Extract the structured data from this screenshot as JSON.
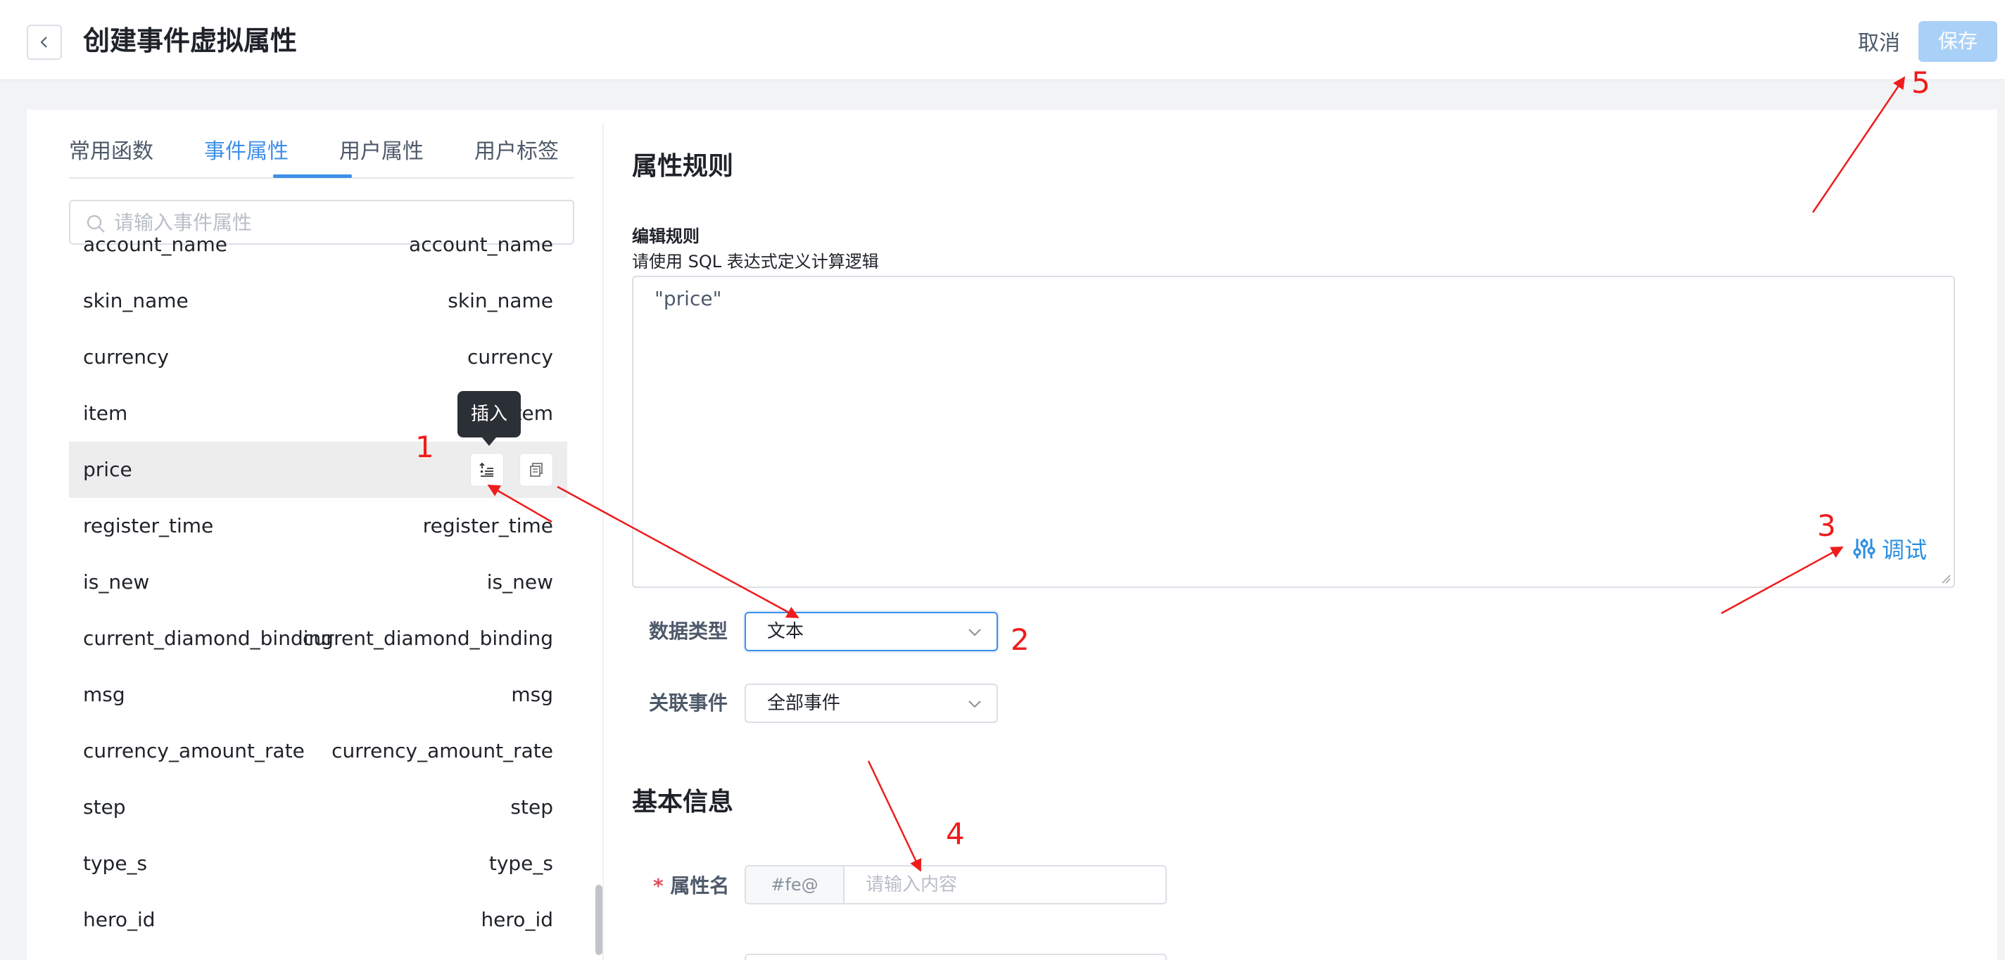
{
  "header": {
    "title": "创建事件虚拟属性",
    "cancel_label": "取消",
    "save_label": "保存"
  },
  "tabs": [
    {
      "label": "常用函数",
      "active": false
    },
    {
      "label": "事件属性",
      "active": true
    },
    {
      "label": "用户属性",
      "active": false
    },
    {
      "label": "用户标签",
      "active": false
    }
  ],
  "search": {
    "placeholder": "请输入事件属性"
  },
  "properties": [
    {
      "name": "account_name",
      "display": "account_name"
    },
    {
      "name": "skin_name",
      "display": "skin_name"
    },
    {
      "name": "currency",
      "display": "currency"
    },
    {
      "name": "item",
      "display": "item"
    },
    {
      "name": "price",
      "display": ""
    },
    {
      "name": "register_time",
      "display": "register_time"
    },
    {
      "name": "is_new",
      "display": "is_new"
    },
    {
      "name": "current_diamond_binding",
      "display": "current_diamond_binding"
    },
    {
      "name": "msg",
      "display": "msg"
    },
    {
      "name": "currency_amount_rate",
      "display": "currency_amount_rate"
    },
    {
      "name": "step",
      "display": "step"
    },
    {
      "name": "type_s",
      "display": "type_s"
    },
    {
      "name": "hero_id",
      "display": "hero_id"
    }
  ],
  "tooltip": {
    "text": "插入"
  },
  "rules": {
    "section_title": "属性规则",
    "edit_label": "编辑规则",
    "edit_desc": "请使用 SQL 表达式定义计算逻辑",
    "expression": "\"price\"",
    "debug_label": "调试"
  },
  "data_type": {
    "label": "数据类型",
    "value": "文本"
  },
  "related_event": {
    "label": "关联事件",
    "value": "全部事件"
  },
  "basic_info": {
    "section_title": "基本信息",
    "name_label": "属性名",
    "required_mark": "*",
    "name_prefix": "#fe@",
    "name_placeholder": "请输入内容"
  },
  "annotations": [
    "1",
    "2",
    "3",
    "4",
    "5"
  ],
  "colors": {
    "accent": "#3f8fe8",
    "annotation": "#ee1c1c",
    "save_disabled": "#a9d1f7"
  }
}
